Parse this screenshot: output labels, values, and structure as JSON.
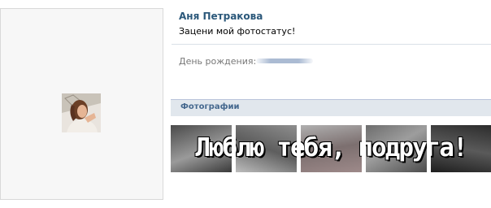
{
  "profile": {
    "name": "Аня Петракова",
    "status": "Зацени мой фотостатус!",
    "birthday_label": "День рождения:"
  },
  "photos": {
    "title": "Фотографии",
    "caption": "Люблю тебя, подруга!",
    "count": 5
  },
  "colors": {
    "name_link": "#2b587a",
    "section_header_bg": "#e1e7ed",
    "section_header_text": "#45688e"
  }
}
